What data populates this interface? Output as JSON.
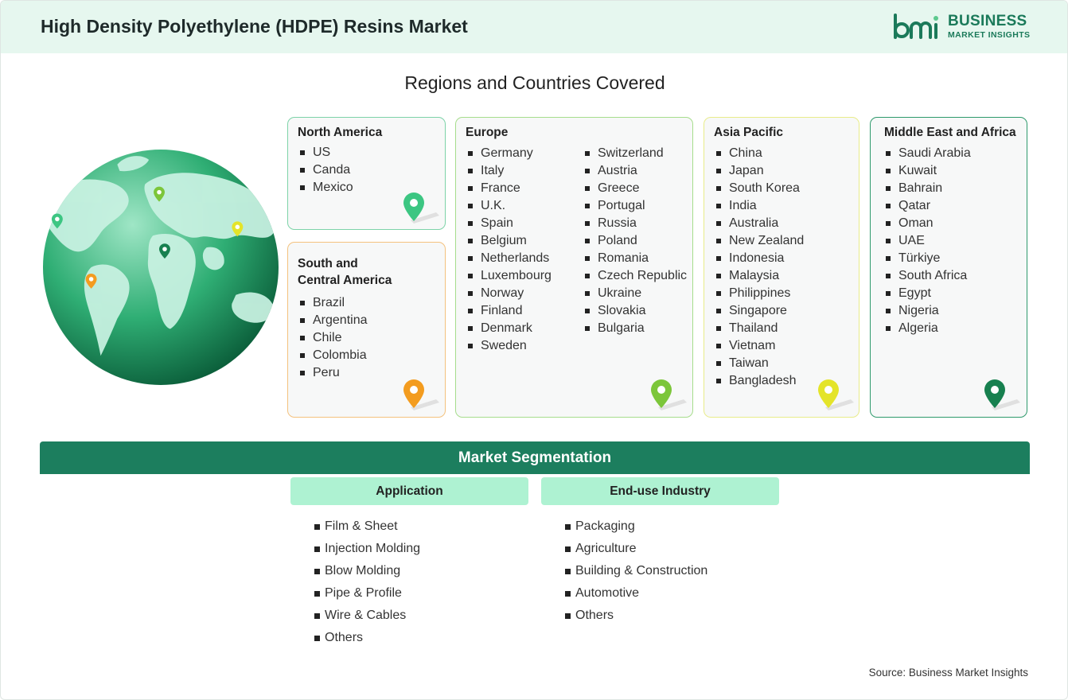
{
  "header": {
    "title": "High Density Polyethylene (HDPE) Resins Market",
    "logo_line1": "BUSINESS",
    "logo_line2": "MARKET INSIGHTS",
    "logo_mark": "bmi",
    "logo_color": "#1b7a5a"
  },
  "regions_title": "Regions and Countries Covered",
  "regions": {
    "north_america": {
      "name": "North America",
      "countries": [
        "US",
        "Canda",
        "Mexico"
      ],
      "pin_color": "#3cc682"
    },
    "south_central_america": {
      "name_line1": "South and",
      "name_line2": "Central America",
      "countries": [
        "Brazil",
        "Argentina",
        "Chile",
        "Colombia",
        "Peru"
      ],
      "pin_color": "#f39c1f"
    },
    "europe": {
      "name": "Europe",
      "countries_col1": [
        "Germany",
        "Italy",
        "France",
        "U.K.",
        "Spain",
        "Belgium",
        "Netherlands",
        "Luxembourg",
        "Norway",
        "Finland",
        "Denmark",
        "Sweden"
      ],
      "countries_col2": [
        "Switzerland",
        "Austria",
        "Greece",
        "Portugal",
        "Russia",
        "Poland",
        "Romania",
        "Czech Republic",
        "Ukraine",
        "Slovakia",
        "Bulgaria"
      ],
      "pin_color": "#7cc63a"
    },
    "asia_pacific": {
      "name": "Asia Pacific",
      "countries": [
        "China",
        "Japan",
        "South Korea",
        "India",
        "Australia",
        "New Zealand",
        "Indonesia",
        "Malaysia",
        "Philippines",
        "Singapore",
        "Thailand",
        "Vietnam",
        "Taiwan",
        "Bangladesh"
      ],
      "pin_color": "#e4e42a"
    },
    "middle_east_africa": {
      "name": "Middle East and Africa",
      "countries": [
        "Saudi Arabia",
        "Kuwait",
        "Bahrain",
        "Qatar",
        "Oman",
        "UAE",
        "Türkiye",
        "South Africa",
        "Egypt",
        "Nigeria",
        "Algeria"
      ],
      "pin_color": "#17804f"
    }
  },
  "segmentation": {
    "title": "Market Segmentation",
    "application": {
      "label": "Application",
      "items": [
        "Film & Sheet",
        "Injection Molding",
        "Blow Molding",
        "Pipe & Profile",
        "Wire & Cables",
        "Others"
      ]
    },
    "end_use": {
      "label": "End-use Industry",
      "items": [
        "Packaging",
        "Agriculture",
        "Building & Construction",
        "Automotive",
        "Others"
      ]
    }
  },
  "source": "Source: Business Market Insights",
  "colors": {
    "header_bg": "#e6f7ef",
    "segmentation_bar": "#1c7e5e",
    "segment_header": "#aef2d2"
  }
}
